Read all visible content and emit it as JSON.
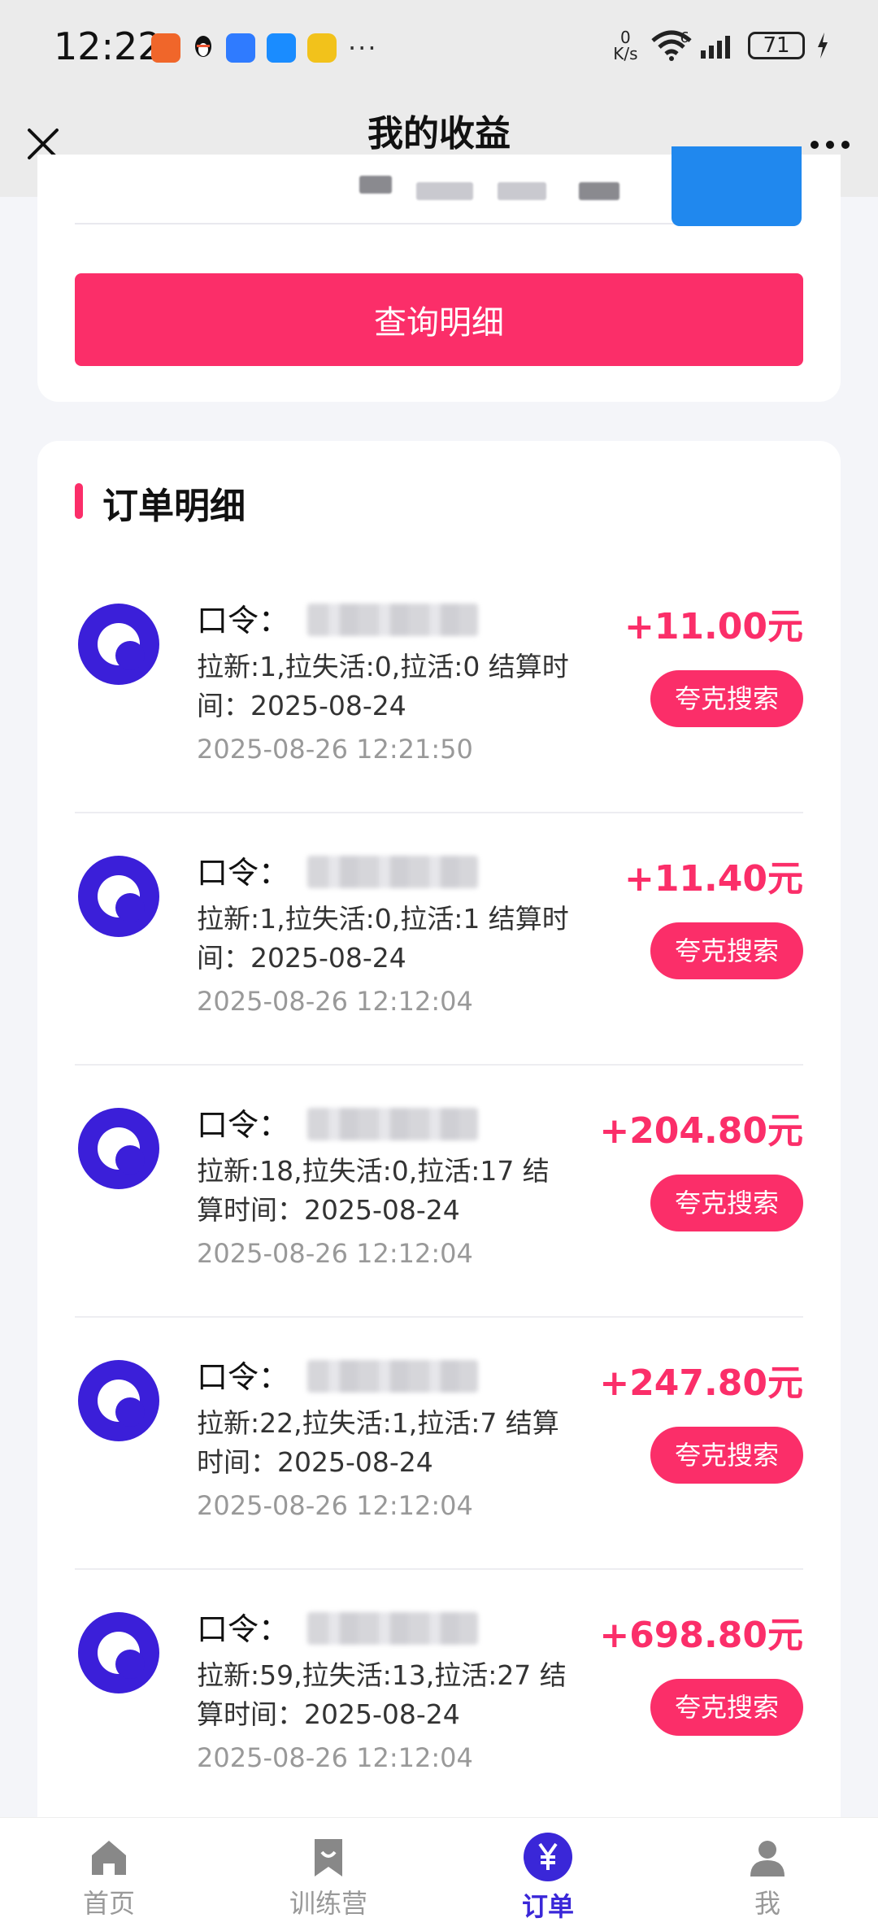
{
  "status_bar": {
    "time": "12:22",
    "more": "···",
    "net_speed_value": "0",
    "net_speed_unit": "K/s",
    "network": "6",
    "battery": "71"
  },
  "title_bar": {
    "title": "我的收益"
  },
  "query": {
    "button_label": "查询明细"
  },
  "orders": {
    "section_title": "订单明细",
    "code_label": "口令：",
    "items": [
      {
        "detail": "拉新:1,拉失活:0,拉活:0 结算时间：2025-08-24",
        "time": "2025-08-26 12:21:50",
        "amount": "+11.00元",
        "tag": "夸克搜索"
      },
      {
        "detail": "拉新:1,拉失活:0,拉活:1 结算时间：2025-08-24",
        "time": "2025-08-26 12:12:04",
        "amount": "+11.40元",
        "tag": "夸克搜索"
      },
      {
        "detail": "拉新:18,拉失活:0,拉活:17 结算时间：2025-08-24",
        "time": "2025-08-26 12:12:04",
        "amount": "+204.80元",
        "tag": "夸克搜索"
      },
      {
        "detail": "拉新:22,拉失活:1,拉活:7 结算时间：2025-08-24",
        "time": "2025-08-26 12:12:04",
        "amount": "+247.80元",
        "tag": "夸克搜索"
      },
      {
        "detail": "拉新:59,拉失活:13,拉活:27 结算时间：2025-08-24",
        "time": "2025-08-26 12:12:04",
        "amount": "+698.80元",
        "tag": "夸克搜索"
      }
    ]
  },
  "bottom_nav": {
    "items": [
      {
        "label": "首页",
        "icon": "home-icon"
      },
      {
        "label": "训练营",
        "icon": "bookmark-icon"
      },
      {
        "label": "订单",
        "icon": "yuan-icon"
      },
      {
        "label": "我",
        "icon": "user-icon"
      }
    ],
    "active_index": 2
  },
  "colors": {
    "accent_pink": "#fb2e69",
    "brand_purple": "#3a27d8",
    "button_blue": "#2088ee"
  }
}
